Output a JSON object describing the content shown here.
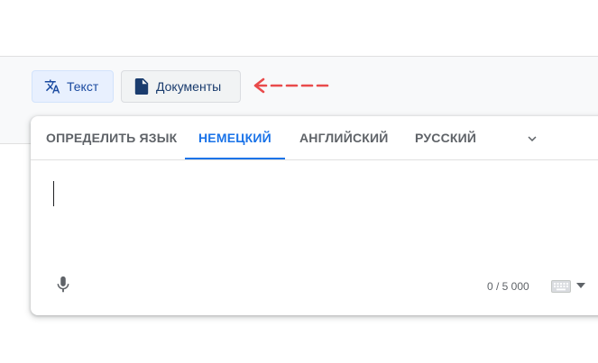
{
  "mode_buttons": {
    "text_label": "Текст",
    "documents_label": "Документы"
  },
  "icons": {
    "translate": "translate-icon",
    "document": "document-icon",
    "arrow": "arrow-left-icon",
    "chevron": "chevron-down-icon",
    "mic": "microphone-icon",
    "keyboard": "keyboard-icon"
  },
  "language_tabs": [
    {
      "label": "ОПРЕДЕЛИТЬ ЯЗЫК",
      "active": false
    },
    {
      "label": "НЕМЕЦКИЙ",
      "active": true
    },
    {
      "label": "АНГЛИЙСКИЙ",
      "active": false
    },
    {
      "label": "РУССКИЙ",
      "active": false
    }
  ],
  "source": {
    "text": "",
    "char_counter": "0 / 5 000"
  },
  "colors": {
    "accent": "#1a73e8",
    "arrow": "#e94b4b",
    "active_button_bg": "#e8f0fe"
  }
}
